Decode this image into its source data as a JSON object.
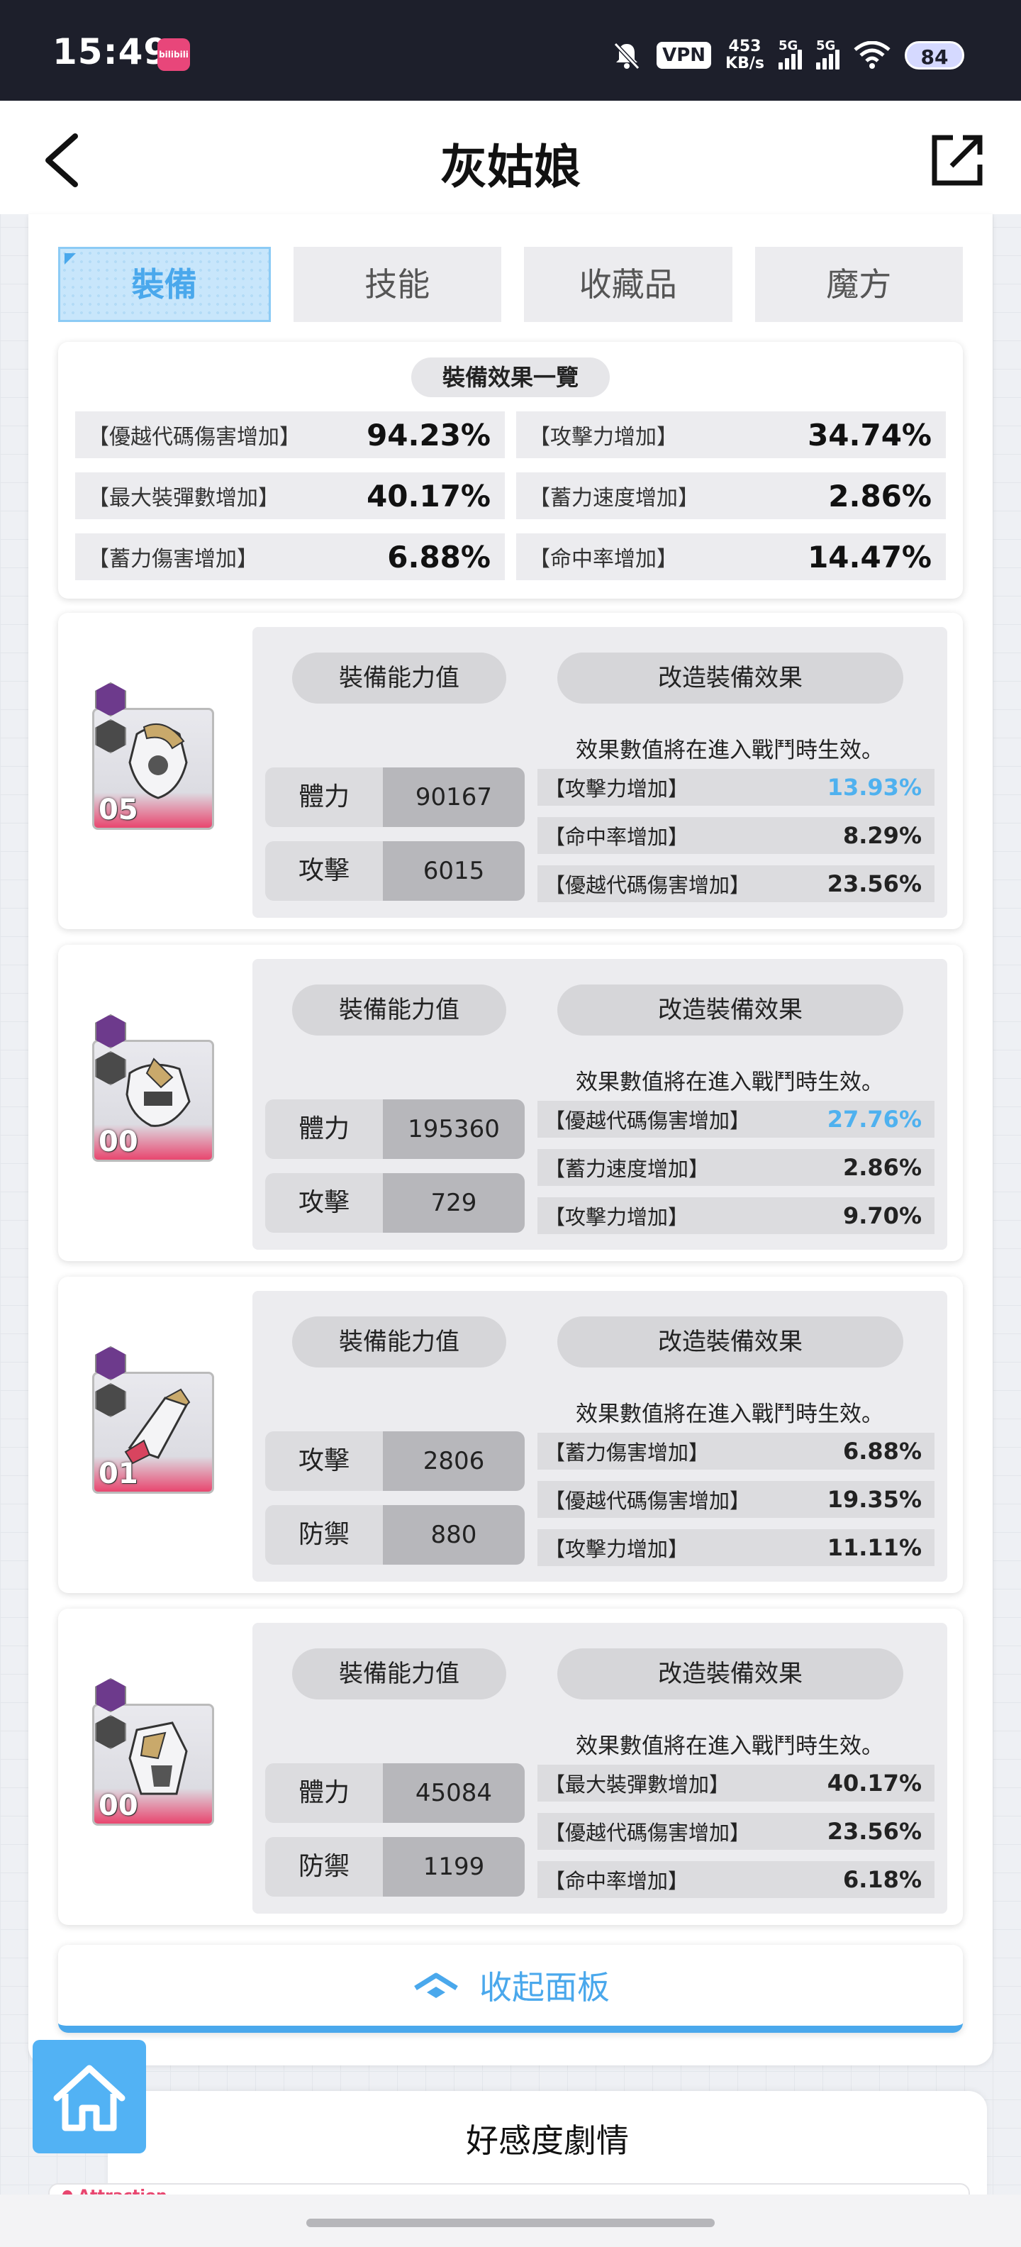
{
  "status_bar": {
    "time": "15:49",
    "app_icon_text": "bilibili",
    "vpn": "VPN",
    "net_speed_value": "453",
    "net_speed_unit": "KB/s",
    "signal_1": "5G",
    "signal_2": "5G",
    "battery": "84"
  },
  "header": {
    "title": "灰姑娘",
    "back_icon": "chevron-left-icon",
    "share_icon": "external-link-icon"
  },
  "tabs": [
    {
      "label": "裝備",
      "active": true
    },
    {
      "label": "技能",
      "active": false
    },
    {
      "label": "收藏品",
      "active": false
    },
    {
      "label": "魔方",
      "active": false
    }
  ],
  "summary": {
    "title": "裝備效果一覽",
    "rows": [
      {
        "label": "【優越代碼傷害增加】",
        "value": "94.23%"
      },
      {
        "label": "【攻擊力增加】",
        "value": "34.74%"
      },
      {
        "label": "【最大裝彈數增加】",
        "value": "40.17%"
      },
      {
        "label": "【蓄力速度增加】",
        "value": "2.86%"
      },
      {
        "label": "【蓄力傷害增加】",
        "value": "6.88%"
      },
      {
        "label": "【命中率增加】",
        "value": "14.47%"
      }
    ]
  },
  "equipment": [
    {
      "level": "05",
      "stats_label": "裝備能力值",
      "mods_label": "改造裝備效果",
      "notice": "效果數值將在進入戰鬥時生效。",
      "stats": [
        {
          "name": "體力",
          "value": "90167"
        },
        {
          "name": "攻擊",
          "value": "6015"
        }
      ],
      "mods": [
        {
          "label": "【攻擊力增加】",
          "value": "13.93%",
          "highlight": true
        },
        {
          "label": "【命中率增加】",
          "value": "8.29%",
          "highlight": false
        },
        {
          "label": "【優越代碼傷害增加】",
          "value": "23.56%",
          "highlight": false
        }
      ]
    },
    {
      "level": "00",
      "stats_label": "裝備能力值",
      "mods_label": "改造裝備效果",
      "notice": "效果數值將在進入戰鬥時生效。",
      "stats": [
        {
          "name": "體力",
          "value": "195360"
        },
        {
          "name": "攻擊",
          "value": "729"
        }
      ],
      "mods": [
        {
          "label": "【優越代碼傷害增加】",
          "value": "27.76%",
          "highlight": true
        },
        {
          "label": "【蓄力速度增加】",
          "value": "2.86%",
          "highlight": false
        },
        {
          "label": "【攻擊力增加】",
          "value": "9.70%",
          "highlight": false
        }
      ]
    },
    {
      "level": "01",
      "stats_label": "裝備能力值",
      "mods_label": "改造裝備效果",
      "notice": "效果數值將在進入戰鬥時生效。",
      "stats": [
        {
          "name": "攻擊",
          "value": "2806"
        },
        {
          "name": "防禦",
          "value": "880"
        }
      ],
      "mods": [
        {
          "label": "【蓄力傷害增加】",
          "value": "6.88%",
          "highlight": false
        },
        {
          "label": "【優越代碼傷害增加】",
          "value": "19.35%",
          "highlight": false
        },
        {
          "label": "【攻擊力增加】",
          "value": "11.11%",
          "highlight": false
        }
      ]
    },
    {
      "level": "00",
      "stats_label": "裝備能力值",
      "mods_label": "改造裝備效果",
      "notice": "效果數值將在進入戰鬥時生效。",
      "stats": [
        {
          "name": "體力",
          "value": "45084"
        },
        {
          "name": "防禦",
          "value": "1199"
        }
      ],
      "mods": [
        {
          "label": "【最大裝彈數增加】",
          "value": "40.17%",
          "highlight": false
        },
        {
          "label": "【優越代碼傷害增加】",
          "value": "23.56%",
          "highlight": false
        },
        {
          "label": "【命中率增加】",
          "value": "6.18%",
          "highlight": false
        }
      ]
    }
  ],
  "collapse": {
    "label": "收起面板",
    "icon": "collapse-up-icon"
  },
  "home": {
    "icon": "home-icon"
  },
  "affinity": {
    "title": "好感度劇情",
    "sub_label": "Attraction"
  },
  "colors": {
    "accent": "#4aa8ec",
    "highlight_value": "#4fb1ef",
    "thumb_pink": "#e8466f"
  }
}
